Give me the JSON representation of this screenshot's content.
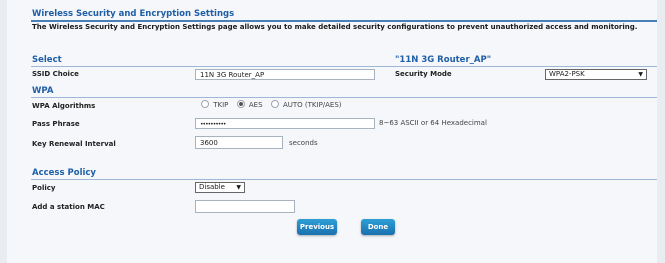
{
  "page": {
    "title": "Wireless Security and Encryption Settings",
    "description": "The Wireless Security and Encryption Settings page allows you to make detailed security configurations to prevent unauthorized access and monitoring."
  },
  "select_section": {
    "title": "Select",
    "ssid_heading": "\"11N 3G Router_AP\"",
    "ssid_label": "SSID Choice",
    "ssid_value": "11N 3G Router_AP",
    "security_mode_label": "Security Mode",
    "security_mode_value": "WPA2-PSK",
    "dropdown_arrow": "▼"
  },
  "wpa_section": {
    "title": "WPA",
    "algorithms_label": "WPA Algorithms",
    "algorithms": [
      {
        "label": "TKIP",
        "selected": false
      },
      {
        "label": "AES",
        "selected": true
      },
      {
        "label": "AUTO (TKIP/AES)",
        "selected": false
      }
    ],
    "pass_phrase_label": "Pass Phrase",
    "pass_phrase_value": "••••••••••",
    "pass_phrase_hint": "8~63 ASCII or 64 Hexadecimal",
    "key_renewal_label": "Key Renewal Interval",
    "key_renewal_value": "3600",
    "key_renewal_unit": "seconds"
  },
  "access_policy": {
    "title": "Access Policy",
    "policy_label": "Policy",
    "policy_value": "Disable",
    "station_mac_label": "Add a station MAC",
    "station_mac_value": ""
  },
  "buttons": {
    "previous": "Previous",
    "done": "Done"
  },
  "colors": {
    "heading": "#1f5fa6",
    "button": "#1a6fae"
  }
}
